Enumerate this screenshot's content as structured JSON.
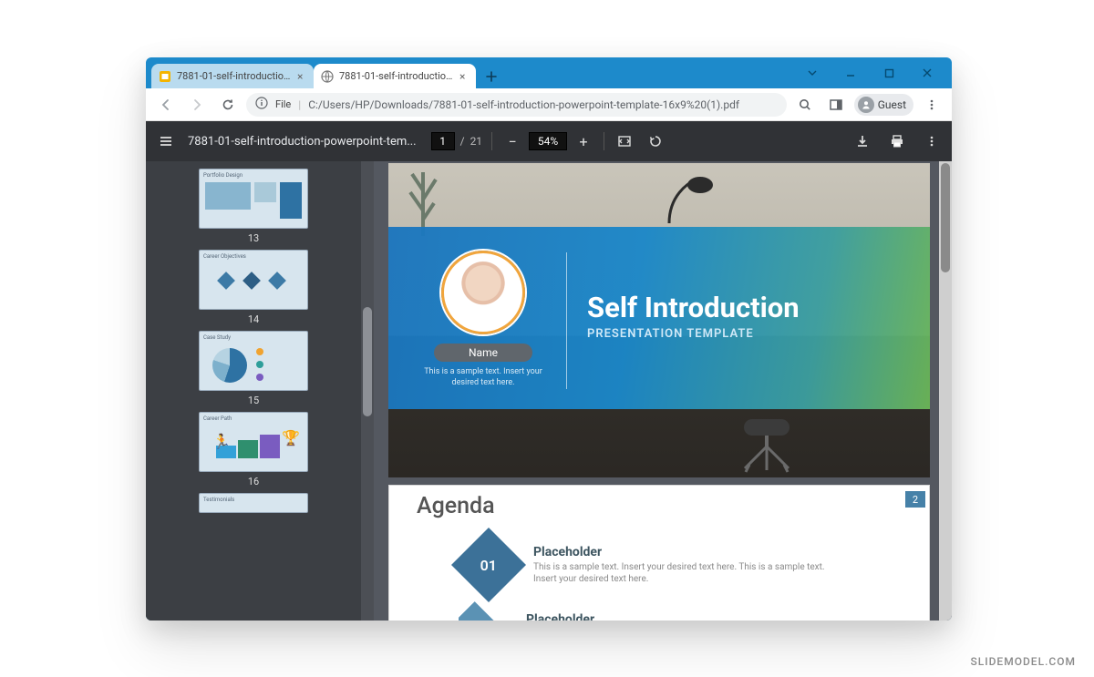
{
  "window": {
    "tabs": [
      {
        "label": "7881-01-self-introduction-powe",
        "active": false
      },
      {
        "label": "7881-01-self-introduction-powe",
        "active": true
      }
    ],
    "guest_label": "Guest"
  },
  "urlbar": {
    "file_chip": "File",
    "url": "C:/Users/HP/Downloads/7881-01-self-introduction-powerpoint-template-16x9%20(1).pdf"
  },
  "pdf_toolbar": {
    "title": "7881-01-self-introduction-powerpoint-tem...",
    "page_current": "1",
    "page_sep": "/",
    "page_total": "21",
    "zoom_value": "54%"
  },
  "thumbnails": [
    {
      "num": "13",
      "caption": "Portfolio Design"
    },
    {
      "num": "14",
      "caption": "Career Objectives"
    },
    {
      "num": "15",
      "caption": "Case Study"
    },
    {
      "num": "16",
      "caption": "Career Path"
    },
    {
      "num": "",
      "caption": "Testimonials"
    }
  ],
  "slide1": {
    "title": "Self Introduction",
    "subtitle": "PRESENTATION TEMPLATE",
    "name": "Name",
    "sample": "This is a sample text. Insert your desired text here."
  },
  "slide2": {
    "title": "Agenda",
    "page_badge": "2",
    "items": [
      {
        "num": "01",
        "title": "Placeholder",
        "desc": "This is a sample text. Insert your desired text here. This is a sample text. Insert your desired text here."
      },
      {
        "num": "",
        "title": "Placeholder",
        "desc": ""
      }
    ]
  },
  "watermark": "SLIDEMODEL.COM"
}
